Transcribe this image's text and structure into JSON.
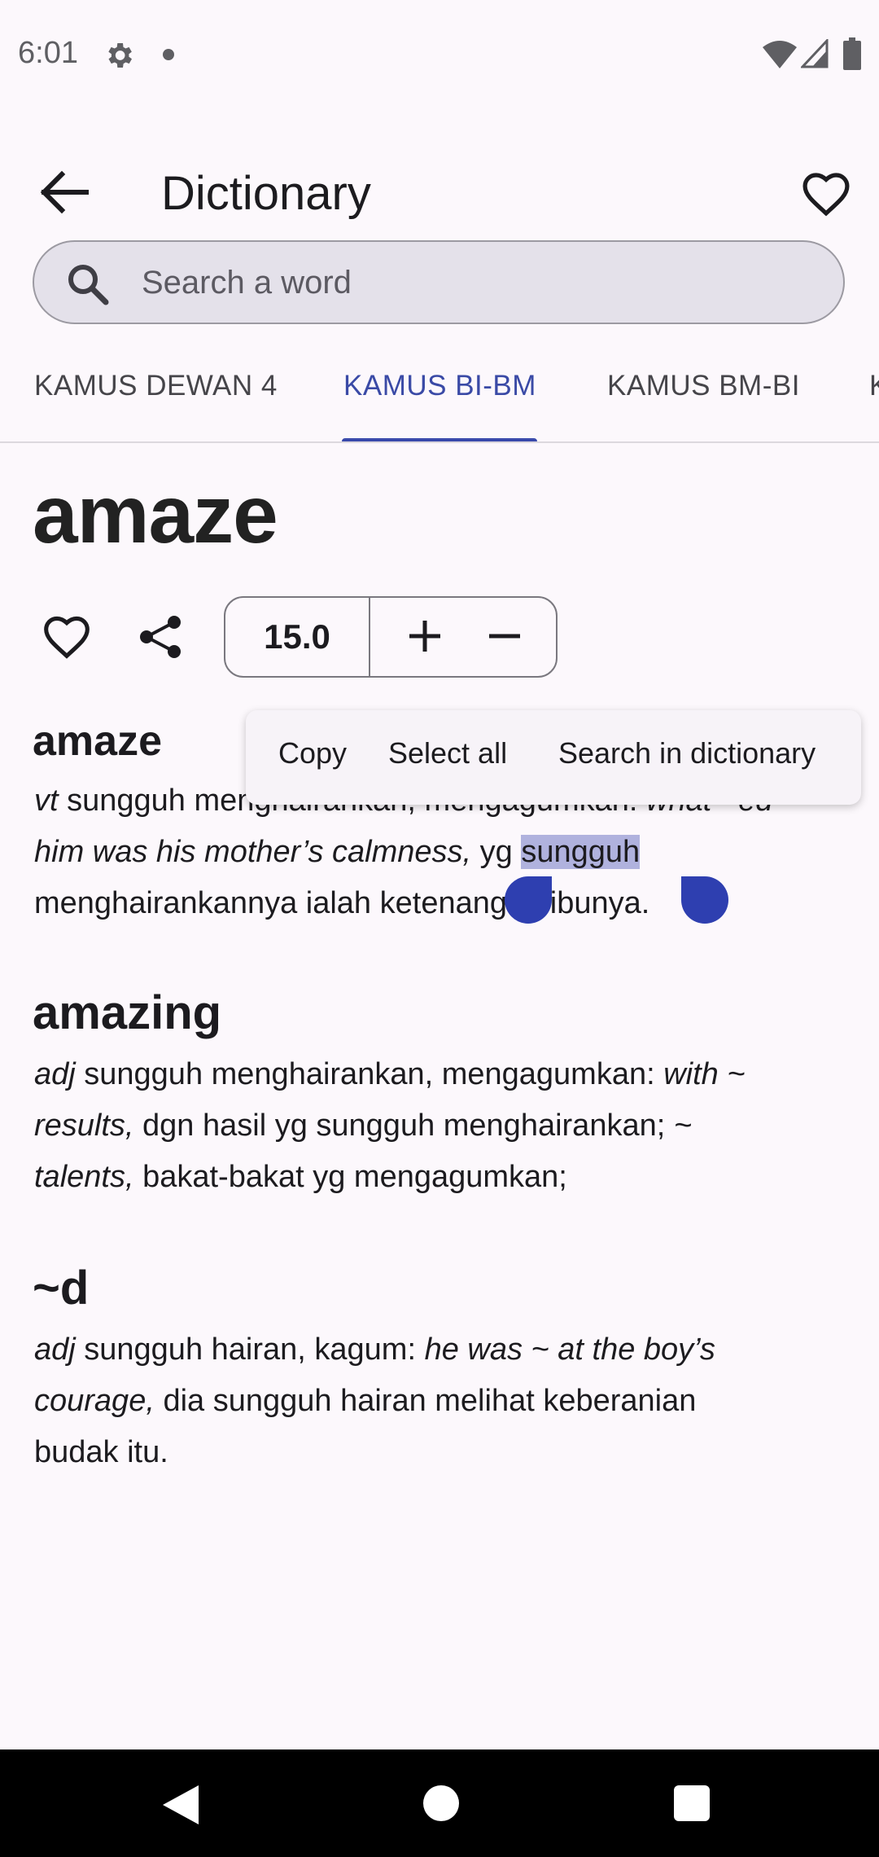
{
  "status_bar": {
    "time": "6:01",
    "icons": [
      "gear-icon",
      "dot-icon",
      "wifi-icon",
      "cell-signal-icon",
      "battery-icon"
    ]
  },
  "app_bar": {
    "title": "Dictionary",
    "back_icon": "arrow-back-icon",
    "favorite_icon": "heart-outline-icon"
  },
  "search": {
    "placeholder": "Search a word",
    "value": ""
  },
  "tabs": [
    {
      "label": "KAMUS DEWAN 4",
      "active": false
    },
    {
      "label": "KAMUS BI-BM",
      "active": true
    },
    {
      "label": "KAMUS BM-BI",
      "active": false
    },
    {
      "label": "K",
      "active": false
    }
  ],
  "headword": "amaze",
  "toolbar": {
    "font_size": "15.0",
    "heart_icon": "heart-outline-icon",
    "share_icon": "share-icon",
    "plus_icon": "plus-icon",
    "minus_icon": "minus-icon"
  },
  "entries": {
    "e1": {
      "title": "amaze",
      "pos": "vt",
      "line1_rest": " sungguh menghairankan, mengagumkan: ",
      "line1_ex": "what ~ed",
      "line2_ex": "him was his mother’s calmness,",
      "line2_plain": " yg ",
      "line2_selected": "sungguh",
      "line3": "menghairankannya ialah ketenangan ibunya."
    },
    "e2": {
      "title": "amazing",
      "pos": "adj",
      "t1": " sungguh menghairankan, mengagumkan: ",
      "ex1a": "with ~",
      "ex1b": "results,",
      "t2": " dgn hasil yg sungguh menghairankan; ",
      "ex2a": "~",
      "ex2b": "talents,",
      "t3": " bakat-bakat yg mengagumkan;"
    },
    "e3": {
      "title": "~d",
      "pos": "adj",
      "t1": " sungguh hairan, kagum: ",
      "ex1a": "he was ~ at the boy’s",
      "ex1b": "courage,",
      "t2": " dia sungguh hairan melihat keberanian",
      "t3": "budak itu."
    }
  },
  "context_menu": {
    "copy": "Copy",
    "select_all": "Select all",
    "search_in_dictionary": "Search in dictionary"
  },
  "colors": {
    "accent": "#3949ab",
    "background": "#fcf8fc",
    "selection": "#b0b2de",
    "search_bg": "#e4e1ea"
  }
}
